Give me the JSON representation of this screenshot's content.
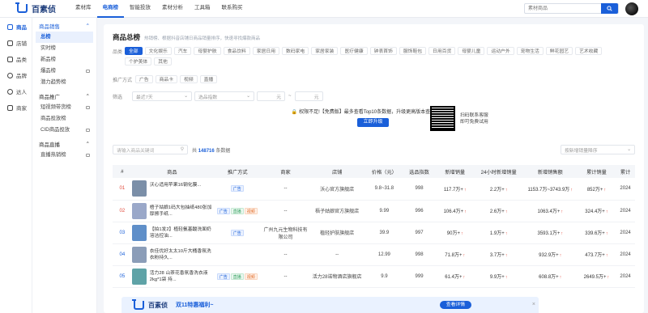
{
  "app": {
    "logo": "百素侦"
  },
  "topnav": [
    {
      "label": "素材库"
    },
    {
      "label": "电商榜",
      "active": true
    },
    {
      "label": "智能投放"
    },
    {
      "label": "素材分析"
    },
    {
      "label": "工具箱"
    },
    {
      "label": "联系购买"
    }
  ],
  "search": {
    "placeholder": "素材商品",
    "icon": "search-icon"
  },
  "left_nav": [
    {
      "label": "商品",
      "icon": "box-icon",
      "active": true
    },
    {
      "label": "店铺",
      "icon": "store-icon"
    },
    {
      "label": "品类",
      "icon": "category-icon"
    },
    {
      "label": "品牌",
      "icon": "brand-icon"
    },
    {
      "label": "达人",
      "icon": "user-icon"
    },
    {
      "label": "商家",
      "icon": "merchant-icon"
    }
  ],
  "submenu": {
    "group1": "商品销售",
    "items1": [
      {
        "label": "总榜",
        "active": true
      },
      {
        "label": "实时榜"
      },
      {
        "label": "新品榜"
      },
      {
        "label": "爆品榜",
        "locked": true
      },
      {
        "label": "潜力趋势榜"
      }
    ],
    "group2": "商品推广",
    "items2": [
      {
        "label": "短视频带货榜",
        "locked": true
      },
      {
        "label": "商品投放榜"
      },
      {
        "label": "CID商品投放",
        "locked": true
      }
    ],
    "group3": "商品直播",
    "items3": [
      {
        "label": "直播热销榜",
        "locked": true
      }
    ]
  },
  "main": {
    "title": "商品总榜",
    "desc": "热销榜、根据抖音店铺日商品销量排序，快速寻找爆款商品",
    "category_label": "品类",
    "categories": [
      "全部",
      "文化娱乐",
      "汽车",
      "母婴护肤",
      "食品饮料",
      "家居日用",
      "数码家电",
      "家居家装",
      "医疗健康",
      "钟表首饰",
      "服饰鞋包",
      "日用百货",
      "母婴儿童",
      "运动户外",
      "宠物生活",
      "鲜花园艺",
      "艺术收藏",
      "个护美体",
      "其他"
    ],
    "promo_label": "推广方式",
    "promos": [
      "广告",
      "商品卡",
      "视频",
      "直播"
    ],
    "filter_label": "筛选",
    "date_range": "最近7天",
    "metric": "选品指数",
    "price_unit_a": "元",
    "price_sep": "~",
    "price_unit_b": "元",
    "banner_text": "权限不足!【免费版】最多查看Top10条数据，升级更高版本查看全量数据",
    "banner_btn": "立即升级",
    "qr_line1": "扫码联系客服",
    "qr_line2": "即可免费试用",
    "keyword_placeholder": "请输入商品关键词",
    "count_prefix": "共",
    "count_value": "148716",
    "count_suffix": "条数据",
    "sort_placeholder": "按新增销量降序"
  },
  "table": {
    "headers": [
      "#",
      "商品",
      "推广方式",
      "商家",
      "店铺",
      "价格（元）",
      "选品指数",
      "新增销量",
      "24小时新增销量",
      "新增销售额",
      "累计销量",
      "累计"
    ],
    "rows": [
      {
        "rank": "01",
        "name": "沃心适用苹果16钢化膜...",
        "tags": [
          "广告"
        ],
        "merchant": "--",
        "store": "沃心官方旗舰店",
        "price": "9.8~31.8",
        "index": "998",
        "sales": "117.7万+",
        "sales24": "2.2万+",
        "amount": "1153.7万~3743.9万",
        "total": "852万+",
        "cum": "2024",
        "thumb": "#7b8fa8"
      },
      {
        "rank": "02",
        "name": "梧子姑娘1码大包抽纸480张加厚擦手纸...",
        "tags": [
          "广告",
          "直播",
          "视频"
        ],
        "merchant": "--",
        "store": "梧子姑娘官方旗舰店",
        "price": "9.99",
        "index": "996",
        "sales": "106.4万+",
        "sales24": "2.6万+",
        "amount": "1063.4万+",
        "total": "324.4万+",
        "cum": "2024",
        "thumb": "#9aa8c9"
      },
      {
        "rank": "03",
        "name": "【拍1发2】植轻氨基酸洗面奶溶洁控油...",
        "tags": [
          "广告"
        ],
        "merchant": "广州九元生物科技有限公司",
        "store": "植轻护肤旗舰店",
        "price": "39.9",
        "index": "997",
        "sales": "90万+",
        "sales24": "1.9万+",
        "amount": "3593.1万+",
        "total": "339.6万+",
        "cum": "2024",
        "thumb": "#5f8fc9"
      },
      {
        "rank": "04",
        "name": "衣佳优好太太10斤大桶香氛洗衣粉持久...",
        "tags": [],
        "merchant": "--",
        "store": "--",
        "price": "12.99",
        "index": "998",
        "sales": "71.8万+",
        "sales24": "3.7万+",
        "amount": "932.9万+",
        "total": "473.7万+",
        "cum": "2024",
        "thumb": "#8b9db8"
      },
      {
        "rank": "05",
        "name": "活力28 山茶花香氛香洗衣液2kg*1袋 持...",
        "tags": [
          "广告",
          "直播",
          "视频"
        ],
        "merchant": "--",
        "store": "活力28诺物酒店旗舰店",
        "price": "9.9",
        "index": "999",
        "sales": "61.4万+",
        "sales24": "9.9万+",
        "amount": "608.8万+",
        "total": "2649.5万+",
        "cum": "2024",
        "thumb": "#5fa3a7"
      }
    ]
  },
  "footer_banner": {
    "logo": "百素侦",
    "text": "双11特惠福利~",
    "button": "查看详情",
    "close": "×"
  },
  "colors": {
    "accent": "#1a5fd9",
    "rank_top": "#e24b3c"
  }
}
